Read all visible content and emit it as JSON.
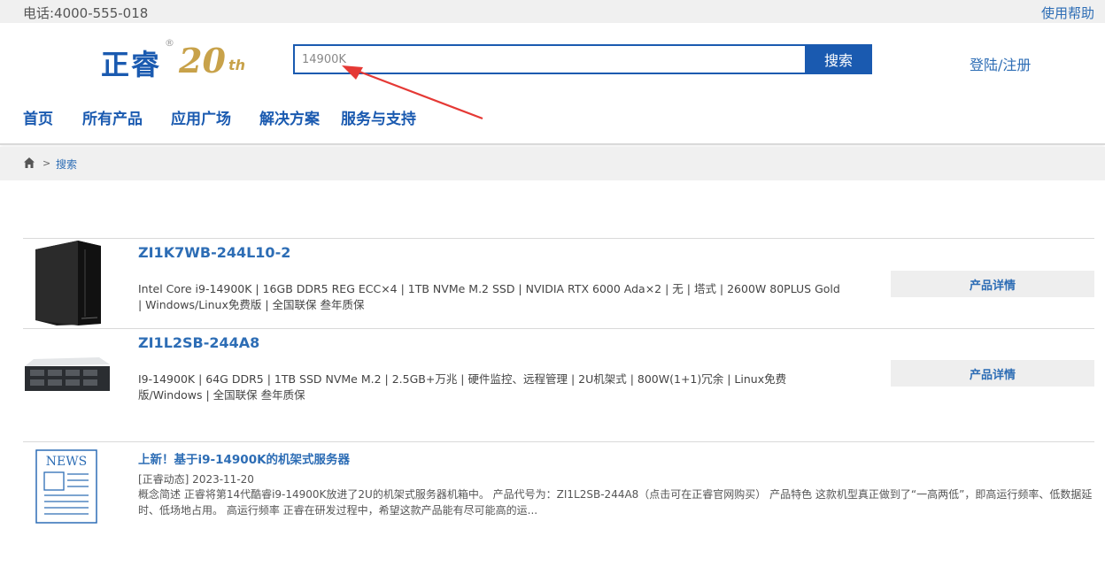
{
  "topbar": {
    "phone": "电话:4000-555-018",
    "help": "使用帮助"
  },
  "logo": {
    "brand": "正睿",
    "reg": "®",
    "anniv": "20",
    "th": "th"
  },
  "search": {
    "value": "14900K",
    "button": "搜索"
  },
  "login": "登陆/注册",
  "nav": [
    "首页",
    "所有产品",
    "应用广场",
    "解决方案",
    "服务与支持"
  ],
  "breadcrumb": {
    "sep": ">",
    "current": "搜索"
  },
  "products": [
    {
      "title": "ZI1K7WB-244L10-2",
      "desc": "Intel Core i9-14900K | 16GB DDR5 REG ECC×4 | 1TB NVMe M.2 SSD | NVIDIA RTX 6000 Ada×2 | 无 | 塔式 | 2600W 80PLUS Gold | Windows/Linux免费版 | 全国联保 叁年质保",
      "button": "产品详情",
      "thumb": "tower-server-image"
    },
    {
      "title": "ZI1L2SB-244A8",
      "desc": "I9-14900K | 64G DDR5 | 1TB SSD NVMe M.2 | 2.5GB+万兆 | 硬件监控、远程管理 | 2U机架式 | 800W(1+1)冗余 | Linux免费版/Windows | 全国联保 叁年质保",
      "button": "产品详情",
      "thumb": "rack-server-image"
    }
  ],
  "news": {
    "icon": "news-icon",
    "icon_text": "NEWS",
    "title": "上新！基于i9-14900K的机架式服务器",
    "meta": "[正睿动态] 2023-11-20",
    "body": "概念简述 正睿将第14代酷睿i9-14900K放进了2U的机架式服务器机箱中。 产品代号为：ZI1L2SB-244A8（点击可在正睿官网购买） 产品特色 这款机型真正做到了“一高两低”，即高运行频率、低数据延时、低场地占用。 高运行频率 正睿在研发过程中，希望这款产品能有尽可能高的运..."
  },
  "colors": {
    "brand_blue": "#1a5ab0",
    "link_blue": "#2d6db5",
    "gold": "#c8a24a",
    "annotation_red": "#e53935"
  }
}
